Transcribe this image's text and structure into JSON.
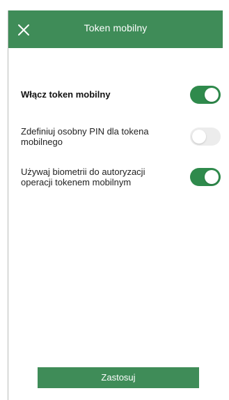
{
  "header": {
    "title": "Token mobilny",
    "close_icon": "close-icon"
  },
  "settings": [
    {
      "label": "Włącz token mobilny",
      "enabled": true
    },
    {
      "label": "Zdefiniuj osobny PIN dla tokena mobilnego",
      "enabled": false
    },
    {
      "label": "Używaj biometrii do autoryzacji operacji tokenem mobilnym",
      "enabled": true
    }
  ],
  "footer": {
    "apply_label": "Zastosuj"
  },
  "colors": {
    "brand": "#3f8c58",
    "toggle_on": "#2f8a4c",
    "toggle_off": "#ececec",
    "text": "#222222"
  }
}
